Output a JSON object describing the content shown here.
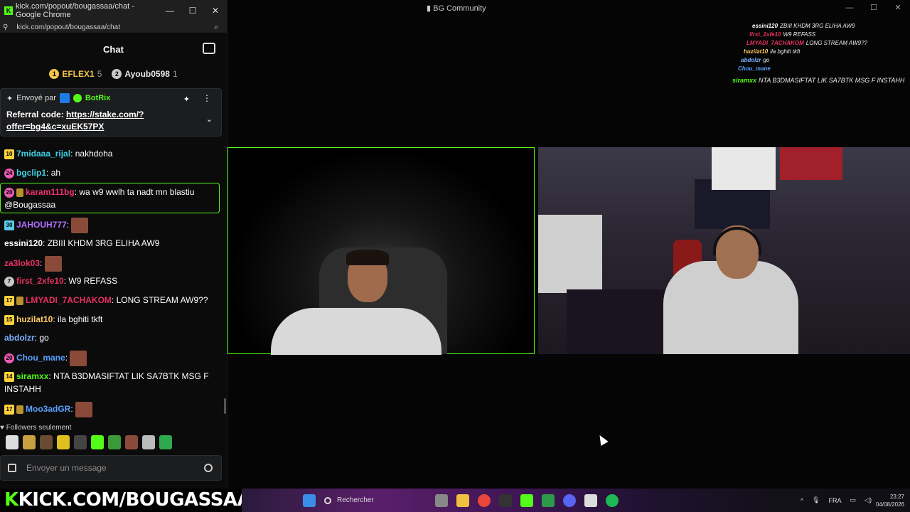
{
  "window": {
    "title": "kick.com/popout/bougassaa/chat - Google Chrome",
    "url": "kick.com/popout/bougassaa/chat",
    "min": "—",
    "max": "☐",
    "close": "✕"
  },
  "chat": {
    "header": "Chat",
    "leaderboard": [
      {
        "rank": "1",
        "name": "EFLEX1",
        "count": "5",
        "color": "#f0c34a"
      },
      {
        "rank": "2",
        "name": "Ayoub0598",
        "count": "1",
        "color": "#c8c8c8"
      }
    ],
    "pinned": {
      "sent_by": "Envoyé par",
      "author": "BotRix",
      "text_label": "Referral code: ",
      "link": "https://stake.com/?offer=bg4&c=xuEK57PX"
    },
    "messages": [
      {
        "level": "10",
        "lvl_style": "y",
        "crown": false,
        "name": "7midaaa_rijal",
        "name_color": "#3fd0e0",
        "text": "nakhdoha",
        "emote": false
      },
      {
        "level": "24",
        "lvl_style": "p",
        "crown": false,
        "name": "bgclip1",
        "name_color": "#3fd0e0",
        "text": "ah",
        "emote": false
      },
      {
        "level": "20",
        "lvl_style": "p",
        "crown": true,
        "name": "karam111bg",
        "name_color": "#f0326e",
        "text": "wa w9 wwlh ta nadt mn blastiu @Bougassaa",
        "emote": false
      },
      {
        "level": "30",
        "lvl_style": "t",
        "crown": false,
        "name": "JAHOUH777",
        "name_color": "#b070ff",
        "text": "",
        "emote": true
      },
      {
        "level": "",
        "lvl_style": "",
        "crown": false,
        "name": "essini120",
        "name_color": "#ffffff",
        "text": "ZBIII KHDM 3RG ELIHA AW9",
        "emote": false
      },
      {
        "level": "",
        "lvl_style": "",
        "crown": false,
        "name": "za3lok03",
        "name_color": "#e83060",
        "text": "",
        "emote": true
      },
      {
        "level": "7",
        "lvl_style": "w",
        "crown": false,
        "name": "first_2xfe10",
        "name_color": "#e83060",
        "text": "W9 REFASS",
        "emote": false
      },
      {
        "level": "17",
        "lvl_style": "y",
        "crown": true,
        "name": "LMYADI_7ACHAKOM",
        "name_color": "#e83060",
        "text": "LONG STREAM AW9??",
        "emote": false
      },
      {
        "level": "15",
        "lvl_style": "y",
        "crown": false,
        "name": "huzilat10",
        "name_color": "#ffcc66",
        "text": "ila bghiti tkft",
        "emote": false
      },
      {
        "level": "",
        "lvl_style": "",
        "crown": false,
        "name": "abdolzr",
        "name_color": "#7ab0ff",
        "text": "go",
        "emote": false
      },
      {
        "level": "20",
        "lvl_style": "p",
        "crown": false,
        "name": "Chou_mane",
        "name_color": "#5aa0ff",
        "text": "",
        "emote": true
      },
      {
        "level": "14",
        "lvl_style": "y",
        "crown": false,
        "name": "siramxx",
        "name_color": "#53fc18",
        "text": "NTA B3DMASIFTAT LIK SA7BTK MSG F INSTAHH",
        "emote": false
      },
      {
        "level": "17",
        "lvl_style": "y",
        "crown": true,
        "name": "Moo3adGR",
        "name_color": "#5aa0ff",
        "text": "",
        "emote": true
      }
    ],
    "followers_label": "Followers seulement",
    "input_placeholder": "Envoyer un message"
  },
  "stage": {
    "title": "BG Community",
    "overlay": [
      {
        "name": "essini120",
        "text": "ZBIII KHDM 3RG ELIHA AW9"
      },
      {
        "name": "first_2xfe10",
        "text": "W9 REFASS"
      },
      {
        "name": "LMYADI_7ACHAKOM",
        "text": "LONG STREAM AW9??"
      },
      {
        "name": "huzilat10",
        "text": "ila bghiti tkft"
      },
      {
        "name": "abdolzr",
        "text": "go"
      },
      {
        "name": "Chou_mane",
        "text": ""
      },
      {
        "name": "siramxx",
        "text": "NTA B3DMASIFTAT LIK SA7BTK MSG F INSTAHH"
      }
    ]
  },
  "banner": {
    "k": "K",
    "rest": "KICK.COM/BOUGASSAA"
  },
  "taskbar": {
    "search": "Rechercher",
    "lang": "FRA",
    "time": "23:27",
    "date": "04/08/2026"
  }
}
